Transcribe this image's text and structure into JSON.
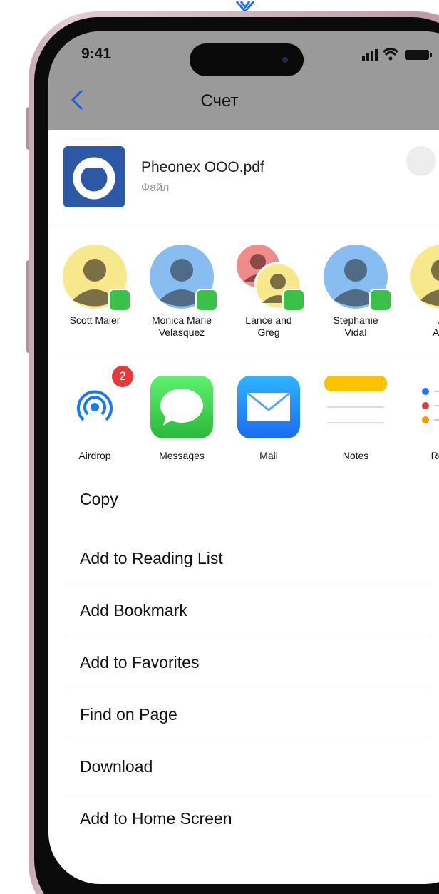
{
  "status_bar": {
    "time": "9:41"
  },
  "nav": {
    "title": "Счет"
  },
  "file": {
    "name": "Pheonex OOO.pdf",
    "type": "Файл"
  },
  "contacts": [
    {
      "name_line1": "Scott Maier",
      "name_line2": ""
    },
    {
      "name_line1": "Monica Marie",
      "name_line2": "Velasquez"
    },
    {
      "name_line1": "Lance and",
      "name_line2": "Greg"
    },
    {
      "name_line1": "Stephanie",
      "name_line2": "Vidal"
    },
    {
      "name_line1": "Jo",
      "name_line2": "Appl"
    }
  ],
  "apps": [
    {
      "label": "Airdrop",
      "badge": "2"
    },
    {
      "label": "Messages"
    },
    {
      "label": "Mail"
    },
    {
      "label": "Notes"
    },
    {
      "label": "Remi"
    }
  ],
  "actions": [
    "Copy",
    "Add to Reading List",
    "Add Bookmark",
    "Add to Favorites",
    "Find on Page",
    "Download",
    "Add to Home Screen"
  ],
  "colors": {
    "header_bg": "#9a9a9a",
    "accent_blue": "#2d58a6",
    "messages_green": "#3bc14a",
    "badge_red": "#e8393a"
  }
}
